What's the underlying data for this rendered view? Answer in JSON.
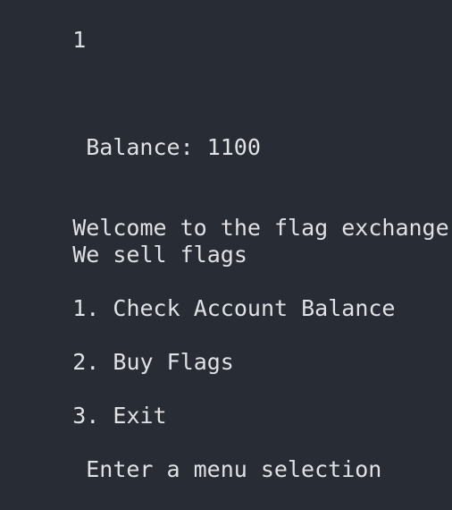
{
  "terminal": {
    "input_echo": "1",
    "balance_label": "Balance:",
    "balance_value": "1100",
    "welcome": "Welcome to the flag exchange",
    "tagline": "We sell flags",
    "menu": [
      {
        "number": "1.",
        "label": "Check Account Balance"
      },
      {
        "number": "2.",
        "label": "Buy Flags"
      },
      {
        "number": "3.",
        "label": "Exit"
      }
    ],
    "prompt": "Enter a menu selection"
  },
  "colors": {
    "background": "#282c34",
    "text": "#dfe1e5"
  }
}
